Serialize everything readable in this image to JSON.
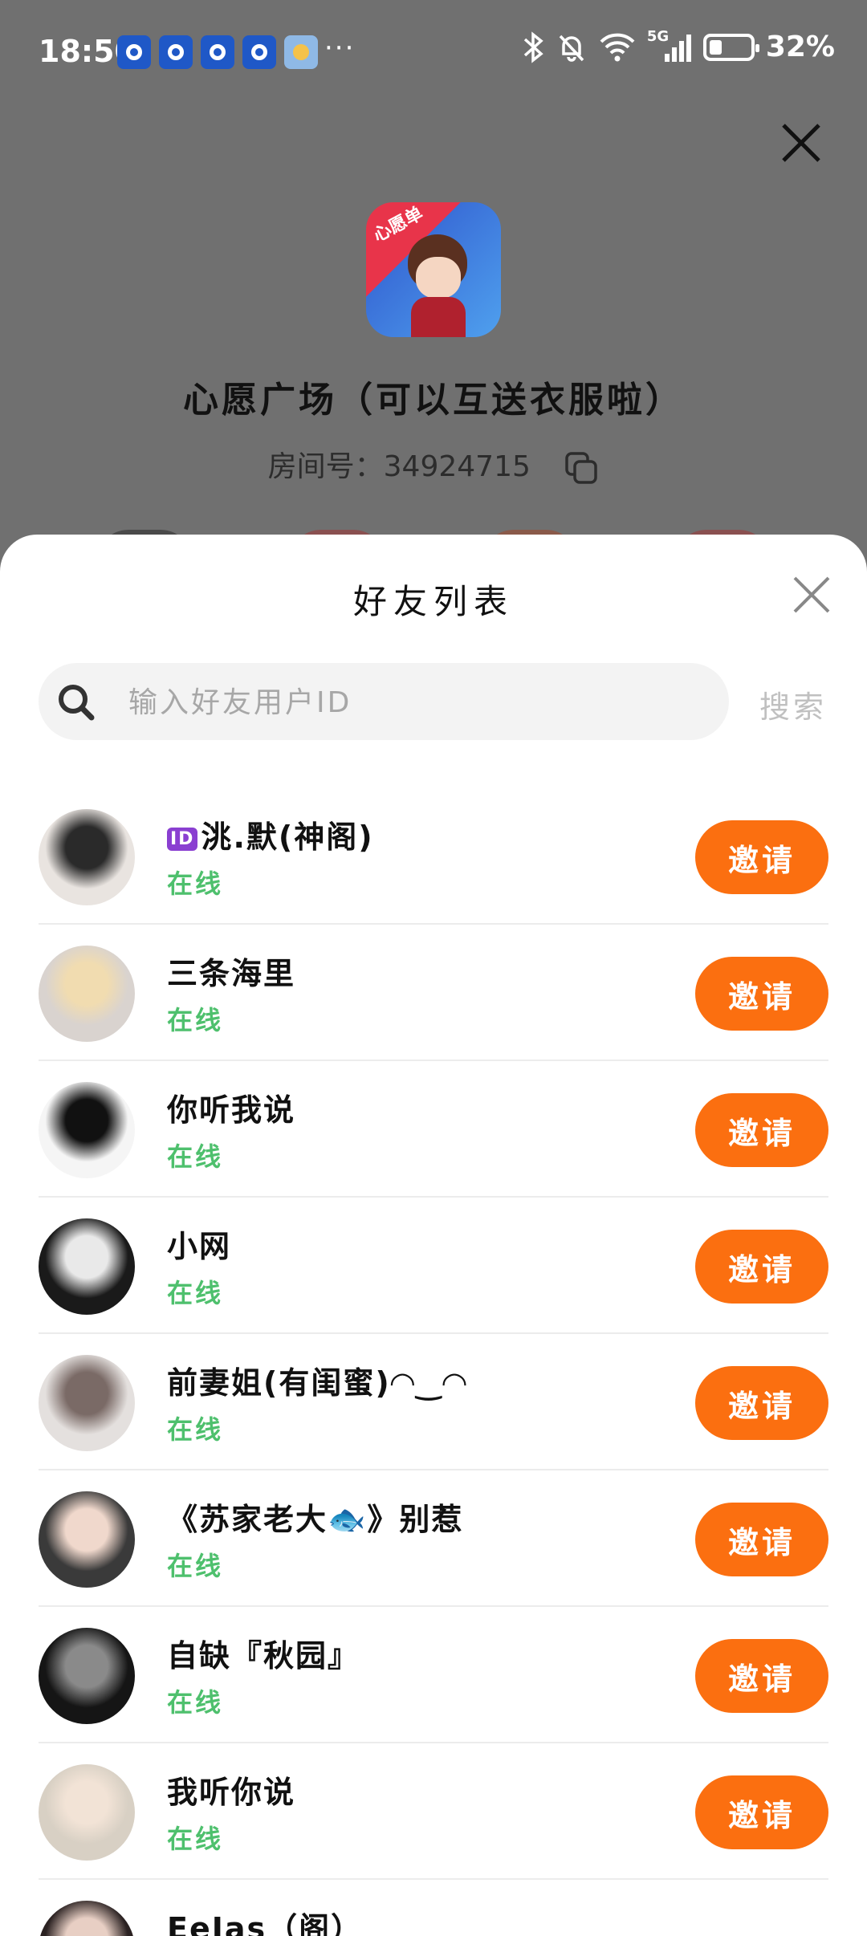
{
  "status_bar": {
    "time": "18:50",
    "more": "···",
    "network": "5G",
    "battery_level": 0.32,
    "battery_text": "32%"
  },
  "room": {
    "logo_text": "心愿单",
    "title": "心愿广场（可以互送衣服啦）",
    "id_label": "房间号：",
    "id_value": "34924715"
  },
  "sheet": {
    "title": "好友列表",
    "search_placeholder": "输入好友用户ID",
    "search_button": "搜索",
    "invite_label": "邀请"
  },
  "friends": [
    {
      "badge": "ID",
      "name": "洮.默(神阁)",
      "status": "在线",
      "avatar_colors": [
        "#e9e4e0",
        "#2a2a2a"
      ]
    },
    {
      "badge": "",
      "name": "三条海里",
      "status": "在线",
      "avatar_colors": [
        "#d9d3cf",
        "#f1dcb0"
      ]
    },
    {
      "badge": "",
      "name": "你听我说",
      "status": "在线",
      "avatar_colors": [
        "#f5f5f5",
        "#111111"
      ]
    },
    {
      "badge": "",
      "name": "小网",
      "status": "在线",
      "avatar_colors": [
        "#1a1a1a",
        "#e9e9e9"
      ]
    },
    {
      "badge": "",
      "name": "前妻姐(有闺蜜)◠‿◠",
      "status": "在线",
      "avatar_colors": [
        "#e4e0de",
        "#7a6a66"
      ]
    },
    {
      "badge": "",
      "name": "《苏家老大🐟》别惹",
      "status": "在线",
      "avatar_colors": [
        "#3a3a3a",
        "#f0d8cc"
      ]
    },
    {
      "badge": "",
      "name": "自缺『秋园』",
      "status": "在线",
      "avatar_colors": [
        "#151515",
        "#8a8a8a"
      ]
    },
    {
      "badge": "",
      "name": "我听你说",
      "status": "在线",
      "avatar_colors": [
        "#d8d0c4",
        "#f2e3d6"
      ]
    },
    {
      "badge": "",
      "name": "EeIas（阁）",
      "status": "",
      "avatar_colors": [
        "#2b2222",
        "#e8cfc4"
      ]
    }
  ],
  "colors": {
    "accent": "#fb6f10",
    "online": "#4ec06d"
  }
}
